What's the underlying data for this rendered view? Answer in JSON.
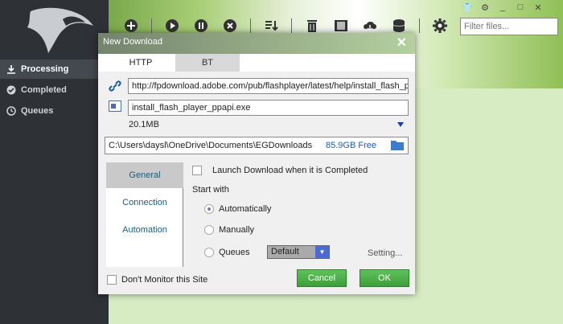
{
  "sidebar": {
    "items": [
      {
        "label": "Processing",
        "icon": "download-icon"
      },
      {
        "label": "Completed",
        "icon": "check-circle-icon"
      },
      {
        "label": "Queues",
        "icon": "clock-icon"
      }
    ]
  },
  "toolbar": {
    "buttons": [
      "add-icon",
      "play-icon",
      "pause-icon",
      "cancel-icon",
      "sort-icon",
      "trash-icon",
      "video-icon",
      "cloud-download-icon",
      "database-icon",
      "gear-icon"
    ]
  },
  "window": {
    "filter_placeholder": "Filter files..."
  },
  "dialog": {
    "title": "New Download",
    "tabs": [
      "HTTP",
      "BT"
    ],
    "url": "http://fpdownload.adobe.com/pub/flashplayer/latest/help/install_flash_pl",
    "filename": "install_flash_player_ppapi.exe",
    "size": "20.1MB",
    "save_path": "C:\\Users\\daysl\\OneDrive\\Documents\\EGDownloads",
    "free_space": "85.9GB Free",
    "option_tabs": [
      "General",
      "Connection",
      "Automation"
    ],
    "launch_label": "Launch Download when it is Completed",
    "start_with_label": "Start with",
    "radio_automatically": "Automatically",
    "radio_manually": "Manually",
    "radio_queues": "Queues",
    "queue_select": "Default",
    "setting_link": "Setting...",
    "dont_monitor_label": "Don't Monitor this Site",
    "cancel_label": "Cancel",
    "ok_label": "OK"
  },
  "colors": {
    "sidebar_bg": "#2e3136",
    "accent_green": "#3f9e3c",
    "link_blue": "#1b5e7f",
    "free_space_blue": "#1a5fb4"
  }
}
